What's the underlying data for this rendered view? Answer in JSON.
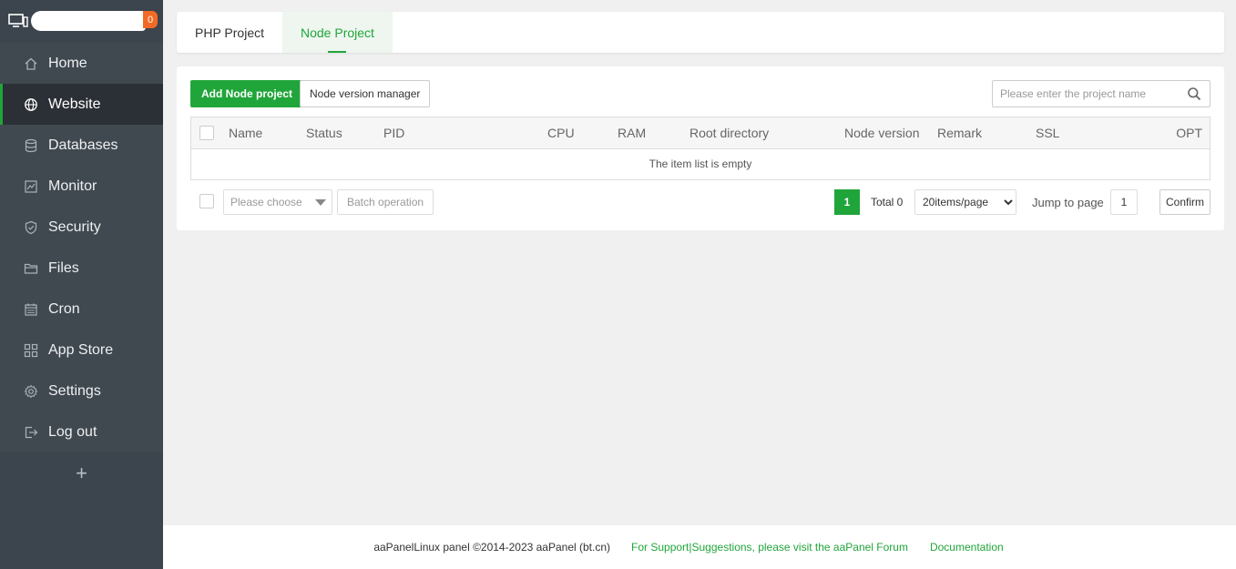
{
  "sidebar": {
    "badge": "0",
    "items": [
      {
        "label": "Home",
        "icon": "home-icon"
      },
      {
        "label": "Website",
        "icon": "globe-icon",
        "active": true
      },
      {
        "label": "Databases",
        "icon": "database-icon"
      },
      {
        "label": "Monitor",
        "icon": "monitor-icon"
      },
      {
        "label": "Security",
        "icon": "shield-icon"
      },
      {
        "label": "Files",
        "icon": "folder-icon"
      },
      {
        "label": "Cron",
        "icon": "calendar-icon"
      },
      {
        "label": "App Store",
        "icon": "grid-icon"
      },
      {
        "label": "Settings",
        "icon": "gear-icon"
      },
      {
        "label": "Log out",
        "icon": "logout-icon"
      }
    ],
    "add_label": "+"
  },
  "tabs": [
    {
      "label": "PHP Project",
      "active": false
    },
    {
      "label": "Node Project",
      "active": true
    }
  ],
  "toolbar": {
    "add_label": "Add Node project",
    "version_label": "Node version manager",
    "search_placeholder": "Please enter the project name"
  },
  "table": {
    "columns": [
      "Name",
      "Status",
      "PID",
      "CPU",
      "RAM",
      "Root directory",
      "Node version",
      "Remark",
      "SSL",
      "OPT"
    ],
    "empty_text": "The item list is empty"
  },
  "pager": {
    "choose_placeholder": "Please choose",
    "batch_label": "Batch operation",
    "current_page": "1",
    "total_text": "Total 0",
    "per_page_selected": "20items/page",
    "jump_label": "Jump to page",
    "jump_value": "1",
    "confirm_label": "Confirm"
  },
  "footer": {
    "copyright": "aaPanelLinux panel ©2014-2023 aaPanel (bt.cn)",
    "support_link": "For Support|Suggestions, please visit the aaPanel Forum",
    "docs_link": "Documentation"
  },
  "colors": {
    "accent": "#20a53a",
    "sidebar_bg": "#3c444d",
    "badge": "#f26a25"
  }
}
